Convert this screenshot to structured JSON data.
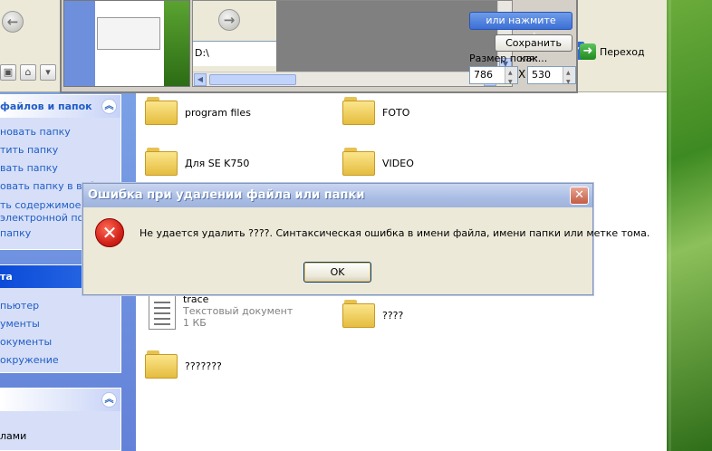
{
  "explorer": {
    "go_label": "Переход",
    "tasks_panel": {
      "title": "файлов и папок",
      "items": [
        "новать папку",
        "тить папку",
        "вать папку",
        "овать папку в веб",
        "ть содержимое эт",
        "электронной поч",
        "папку"
      ]
    },
    "places_panel": {
      "title": "та",
      "items": [
        "пьютер",
        "ументы",
        "окументы",
        "окружение"
      ]
    },
    "details_panel": {
      "title": "",
      "items": [
        "лами"
      ]
    },
    "files": [
      {
        "name": "program files",
        "type": "folder"
      },
      {
        "name": "FOTO",
        "type": "folder"
      },
      {
        "name": "Для SE K750",
        "type": "folder"
      },
      {
        "name": "VIDEO",
        "type": "folder"
      },
      {
        "name": "trace",
        "type": "document",
        "kind": "Текстовый документ",
        "size": "1 КБ"
      },
      {
        "name": "????",
        "type": "folder"
      },
      {
        "name": "???????",
        "type": "folder"
      }
    ]
  },
  "capture_tool": {
    "path_text": "D:\\",
    "click_here_button": "или нажмите сюда!",
    "save_as_button": "Сохранить как...",
    "size_label": "Размер поля:",
    "width_value": "786",
    "height_value": "530",
    "times_sign": "X"
  },
  "dialog": {
    "title": "Ошибка при удалении файла или папки",
    "message": "Не удается удалить ????. Синтаксическая ошибка в имени файла, имени папки или метке тома.",
    "ok_label": "OK",
    "close_glyph": "✕",
    "error_glyph": "✕"
  },
  "colors": {
    "dialog_title_start": "#c9d6f0",
    "dialog_title_end": "#9fb3dc",
    "error_red": "#d2231a",
    "task_link": "#215dc6"
  }
}
